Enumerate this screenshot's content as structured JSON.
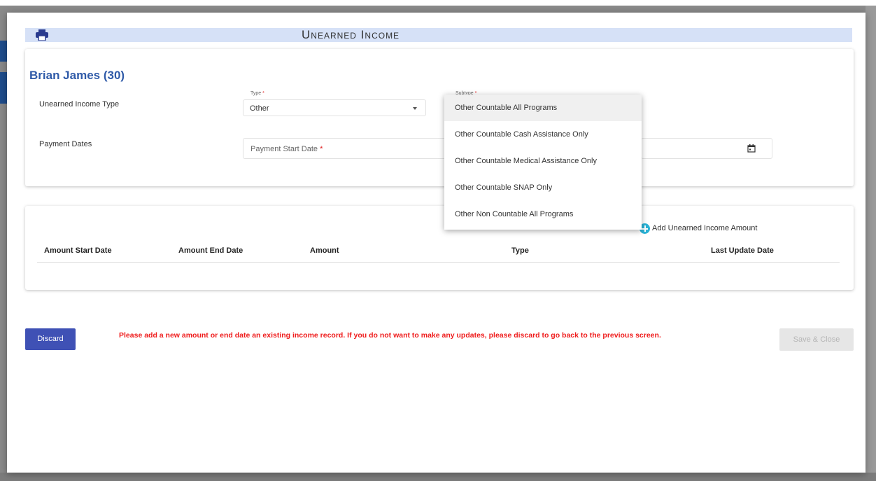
{
  "dialog": {
    "title": "Unearned Income",
    "person_name": "Brian James (30)"
  },
  "form": {
    "unearned_income_type_label": "Unearned Income Type",
    "type_label": "Type",
    "type_value": "Other",
    "subtype_label": "Subtype",
    "payment_dates_label": "Payment Dates",
    "payment_start_placeholder": "Payment Start Date",
    "required_mark": "*"
  },
  "subtype_dropdown": {
    "options": [
      "Other Countable All Programs",
      "Other Countable Cash Assistance Only",
      "Other Countable Medical Assistance Only",
      "Other Countable SNAP Only",
      "Other Non Countable All Programs"
    ],
    "highlighted_index": 0
  },
  "amounts_table": {
    "add_label": "Add Unearned Income Amount",
    "columns": [
      "Amount Start Date",
      "Amount End Date",
      "Amount",
      "Type",
      "Last Update Date"
    ],
    "rows": []
  },
  "footer": {
    "discard_label": "Discard",
    "warning": "Please add a new amount or end date an existing income record. If you do not want to make any updates, please discard to go back to the previous screen.",
    "save_label": "Save & Close"
  },
  "colors": {
    "accent": "#3f51b5",
    "person_name": "#2f5aa8",
    "warning": "#ef1c1c",
    "title_bar": "#d6e1f7",
    "add_icon": "#2bb3d6"
  },
  "icons": [
    "print-icon",
    "caret-down-icon",
    "calendar-icon",
    "add-circle-icon"
  ]
}
